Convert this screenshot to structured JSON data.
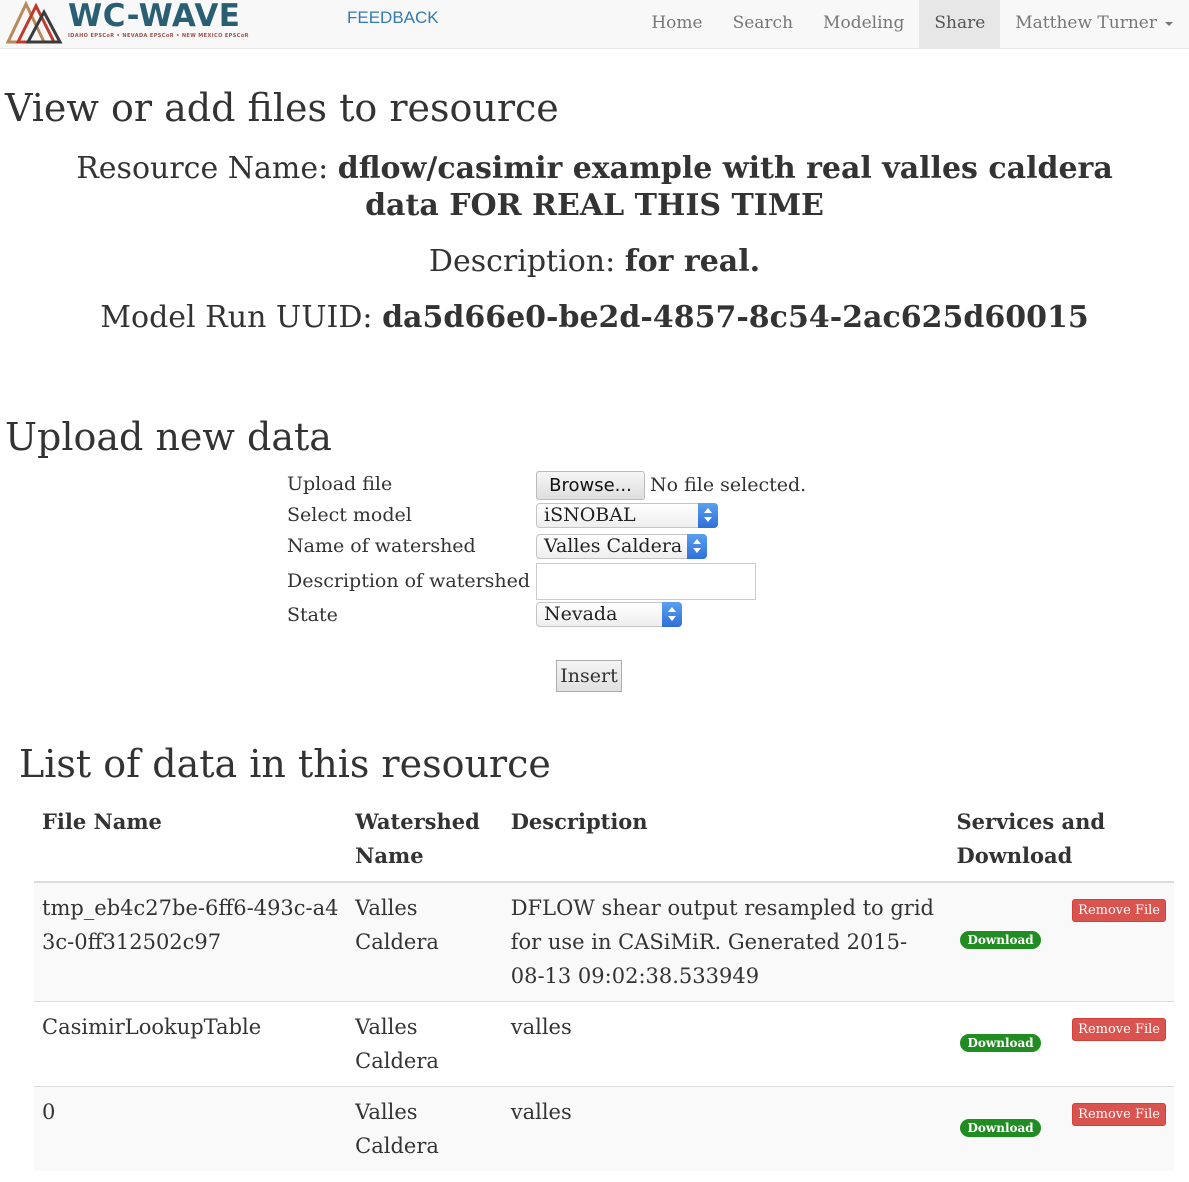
{
  "navbar": {
    "logo_text": "WC-WAVE",
    "logo_sub": "IDAHO EPSCoR  •  NEVADA EPSCoR  •  NEW MEXICO EPSCoR",
    "feedback": "FEEDBACK",
    "items": [
      "Home",
      "Search",
      "Modeling",
      "Share"
    ],
    "active": "Share",
    "user": "Matthew Turner"
  },
  "page": {
    "title": "View or add files to resource",
    "resource_name_label": "Resource Name:",
    "resource_name": "dflow/casimir example with real valles caldera data FOR REAL THIS TIME",
    "description_label": "Description:",
    "description": "for real.",
    "uuid_label": "Model Run UUID:",
    "uuid": "da5d66e0-be2d-4857-8c54-2ac625d60015"
  },
  "upload": {
    "title": "Upload new data",
    "file_label": "Upload file",
    "browse_label": "Browse...",
    "no_file": "No file selected.",
    "model_label": "Select model",
    "model_value": "iSNOBAL",
    "watershed_label": "Name of watershed",
    "watershed_value": "Valles Caldera",
    "desc_label": "Description of watershed",
    "desc_value": "",
    "state_label": "State",
    "state_value": "Nevada",
    "insert_label": "Insert"
  },
  "list": {
    "title": "List of data in this resource",
    "columns": [
      "File Name",
      "Watershed Name",
      "Description",
      "Services and Download"
    ],
    "download_label": "Download",
    "remove_label": "Remove File",
    "rows": [
      {
        "file": "tmp_eb4c27be-6ff6-493c-a43c-0ff312502c97",
        "watershed": "Valles Caldera",
        "description": "DFLOW shear output resampled to grid for use in CASiMiR. Generated 2015-08-13 09:02:38.533949"
      },
      {
        "file": "CasimirLookupTable",
        "watershed": "Valles Caldera",
        "description": "valles"
      },
      {
        "file": "0",
        "watershed": "Valles Caldera",
        "description": "valles"
      }
    ]
  },
  "colors": {
    "brand": "#2a5f73",
    "link": "#337ab7",
    "download": "#218c21",
    "remove": "#d9534f"
  }
}
